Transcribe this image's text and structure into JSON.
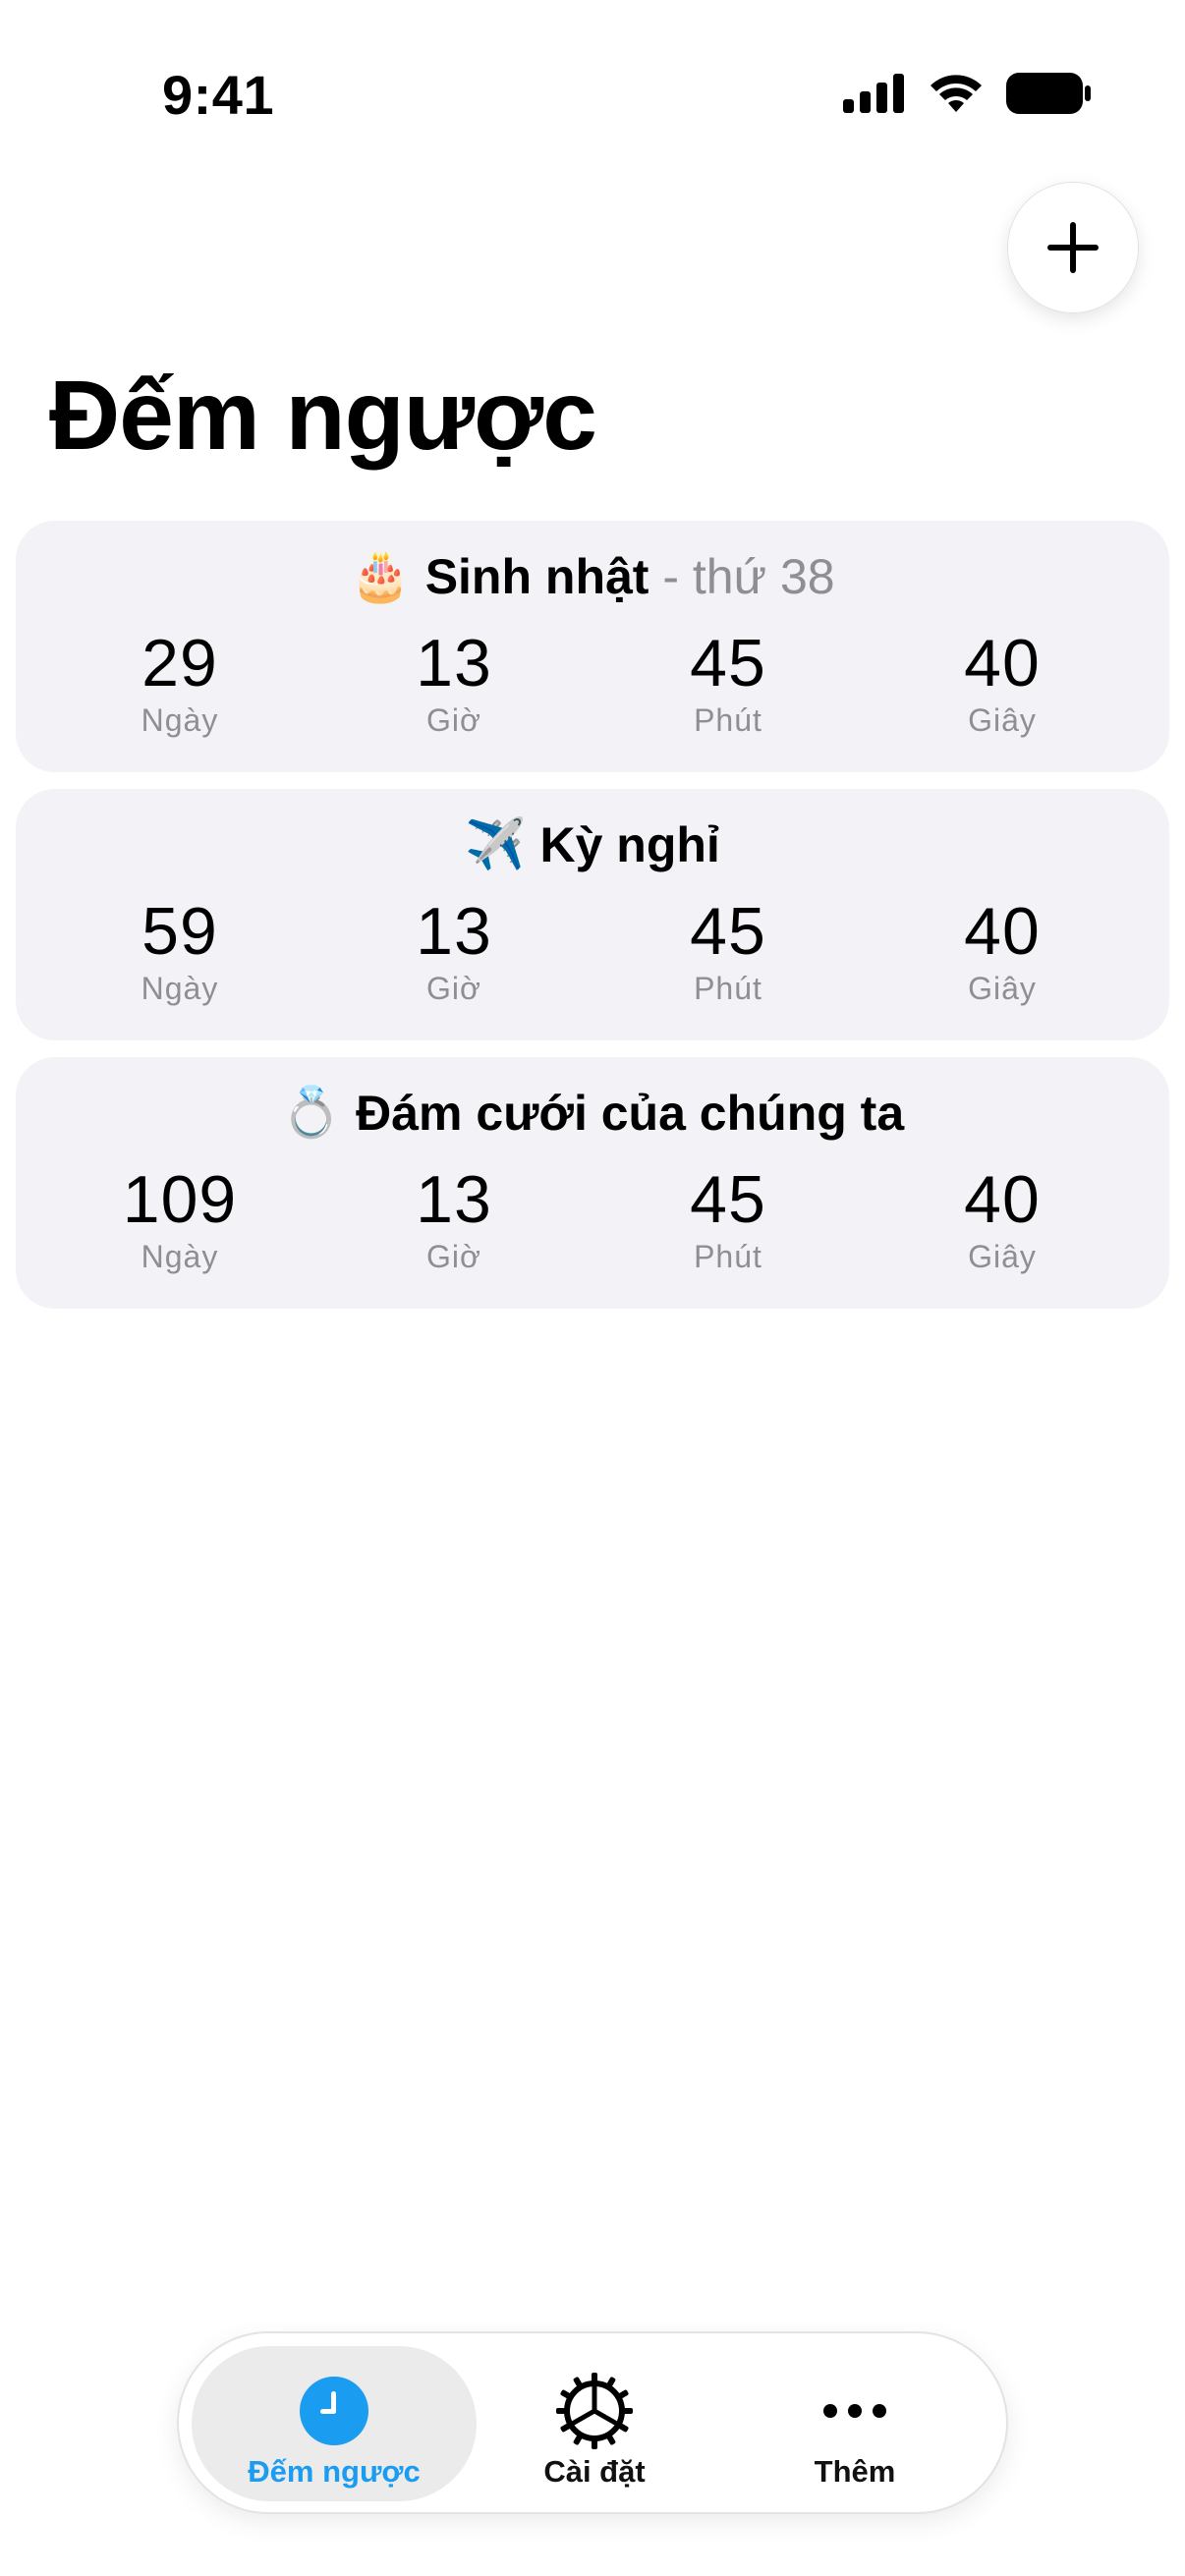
{
  "status_bar": {
    "time": "9:41"
  },
  "header": {
    "title": "Đếm ngược",
    "add_icon": "plus-icon"
  },
  "countdowns": [
    {
      "emoji": "🎂",
      "title": "Sinh nhật",
      "subtitle": " - thứ 38",
      "days": "29",
      "hours": "13",
      "minutes": "45",
      "seconds": "40"
    },
    {
      "emoji": "✈️",
      "title": "Kỳ nghỉ",
      "subtitle": "",
      "days": "59",
      "hours": "13",
      "minutes": "45",
      "seconds": "40"
    },
    {
      "emoji": "💍",
      "title": "Đám cưới của chúng ta",
      "subtitle": "",
      "days": "109",
      "hours": "13",
      "minutes": "45",
      "seconds": "40"
    }
  ],
  "units": {
    "days": "Ngày",
    "hours": "Giờ",
    "minutes": "Phút",
    "seconds": "Giây"
  },
  "tab_bar": {
    "tabs": [
      {
        "label": "Đếm ngược",
        "icon": "clock-icon",
        "active": true
      },
      {
        "label": "Cài đặt",
        "icon": "gear-icon",
        "active": false
      },
      {
        "label": "Thêm",
        "icon": "more-icon",
        "active": false
      }
    ]
  },
  "colors": {
    "accent": "#1a9cf0",
    "card_background": "#f2f2f7",
    "secondary_text": "#8e8e93"
  }
}
